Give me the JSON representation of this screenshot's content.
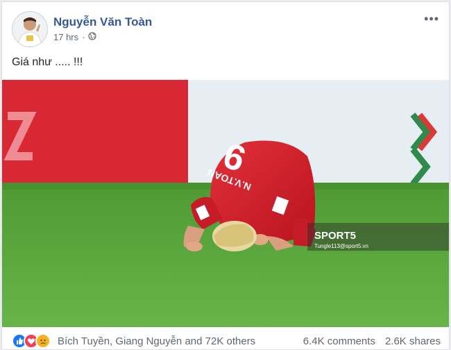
{
  "post": {
    "author": "Nguyễn Văn Toàn",
    "time": "17 hrs",
    "audience_icon": "globe-icon",
    "text": "Giá như ..... !!!",
    "more_label": "•••"
  },
  "photo": {
    "jersey_number": "9",
    "jersey_name": "N.V.TOAN",
    "watermark_brand": "SPORT5",
    "watermark_site": "Tungle113@sport5.vn"
  },
  "footer": {
    "reaction_icons": [
      "like-icon",
      "love-icon",
      "sad-icon"
    ],
    "reactors": "Bích Tuyền, Giang Nguyễn and 72K others",
    "comments": "6.4K comments",
    "shares": "2.6K shares"
  },
  "colors": {
    "author_blue": "#365899",
    "like_blue": "#1877f2",
    "love_red": "#f33e58",
    "sad_yellow": "#f7b125",
    "pitch_green": "#5aa43c",
    "jersey_red": "#d21f2a"
  }
}
